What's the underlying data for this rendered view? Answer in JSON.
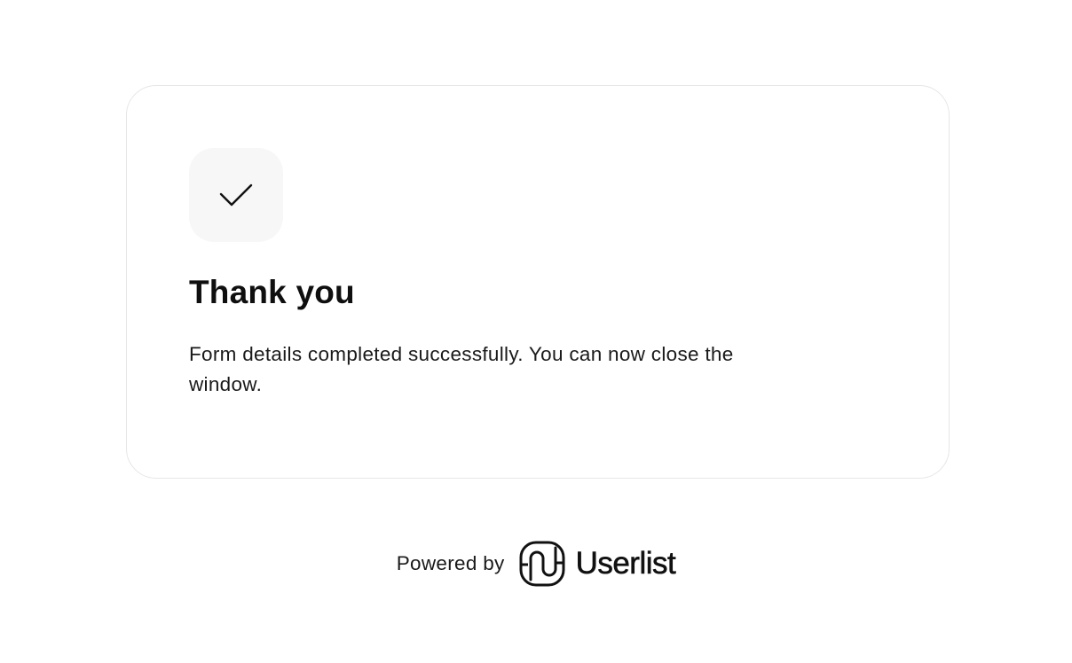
{
  "card": {
    "icon": "check-icon",
    "title": "Thank you",
    "message": "Form details completed successfully. You can now close the window."
  },
  "footer": {
    "powered_by": "Powered by",
    "brand_icon": "userlist-logo-icon",
    "brand_name": "Userlist"
  },
  "colors": {
    "background": "#ffffff",
    "card_border": "#e6e6e6",
    "icon_tile": "#f7f7f7",
    "text": "#111111"
  }
}
